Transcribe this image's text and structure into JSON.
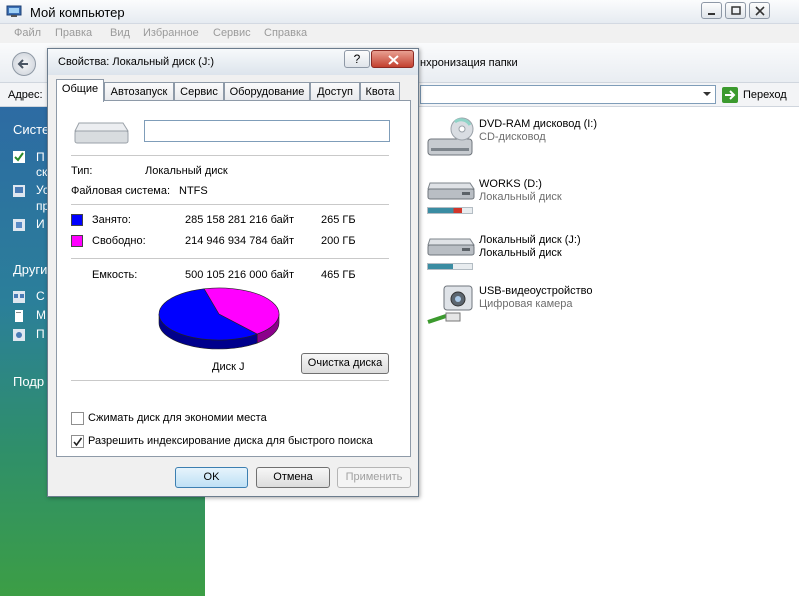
{
  "window": {
    "title": "Мой компьютер"
  },
  "menu": [
    "Файл",
    "Правка",
    "Вид",
    "Избранное",
    "Сервис",
    "Справка"
  ],
  "toolbar": {
    "sync_label": "нхронизация папки"
  },
  "address": {
    "label": "Адрес:",
    "go_label": "Переход"
  },
  "taskpane": {
    "sections": [
      "Систе",
      "Други",
      "Подр"
    ],
    "items": [
      "П",
      "ск",
      "Ус",
      "пр",
      "И",
      "С",
      "М",
      "П"
    ]
  },
  "drives": [
    {
      "name": "DVD-RAM дисковод (I:)",
      "sub": "CD-дисковод",
      "used_fraction": null
    },
    {
      "name": "WORKS (D:)",
      "sub": "Локальный диск",
      "used_fraction": 0.78
    },
    {
      "name": "Локальный диск (J:)",
      "sub": "Локальный диск",
      "used_fraction": 0.57
    },
    {
      "name": "USB-видеоустройство",
      "sub": "Цифровая камера",
      "used_fraction": null
    }
  ],
  "dialog": {
    "title": "Свойства: Локальный диск (J:)",
    "help_label": "?",
    "tabs": [
      "Общие",
      "Автозапуск",
      "Сервис",
      "Оборудование",
      "Доступ",
      "Квота"
    ],
    "active_tab": "Общие",
    "name_value": "",
    "type_label": "Тип:",
    "type_value": "Локальный диск",
    "fs_label": "Файловая система:",
    "fs_value": "NTFS",
    "used": {
      "label": "Занято:",
      "bytes": "285 158 281 216 байт",
      "size": "265 ГБ",
      "color": "#0000ff"
    },
    "free": {
      "label": "Свободно:",
      "bytes": "214 946 934 784 байт",
      "size": "200 ГБ",
      "color": "#ff00ff"
    },
    "capacity": {
      "label": "Емкость:",
      "bytes": "500 105 216 000 байт",
      "size": "465 ГБ"
    },
    "disk_label": "Диск J",
    "cleanup_label": "Очистка диска",
    "compress_label": "Сжимать диск для экономии места",
    "compress_checked": false,
    "index_label": "Разрешить индексирование диска для быстрого поиска",
    "index_checked": true,
    "ok_label": "OK",
    "cancel_label": "Отмена",
    "apply_label": "Применить"
  },
  "chart_data": {
    "type": "pie",
    "categories": [
      "Занято",
      "Свободно"
    ],
    "values": [
      285158281216,
      214946934784
    ],
    "colors": [
      "#0000ff",
      "#ff00ff"
    ]
  }
}
